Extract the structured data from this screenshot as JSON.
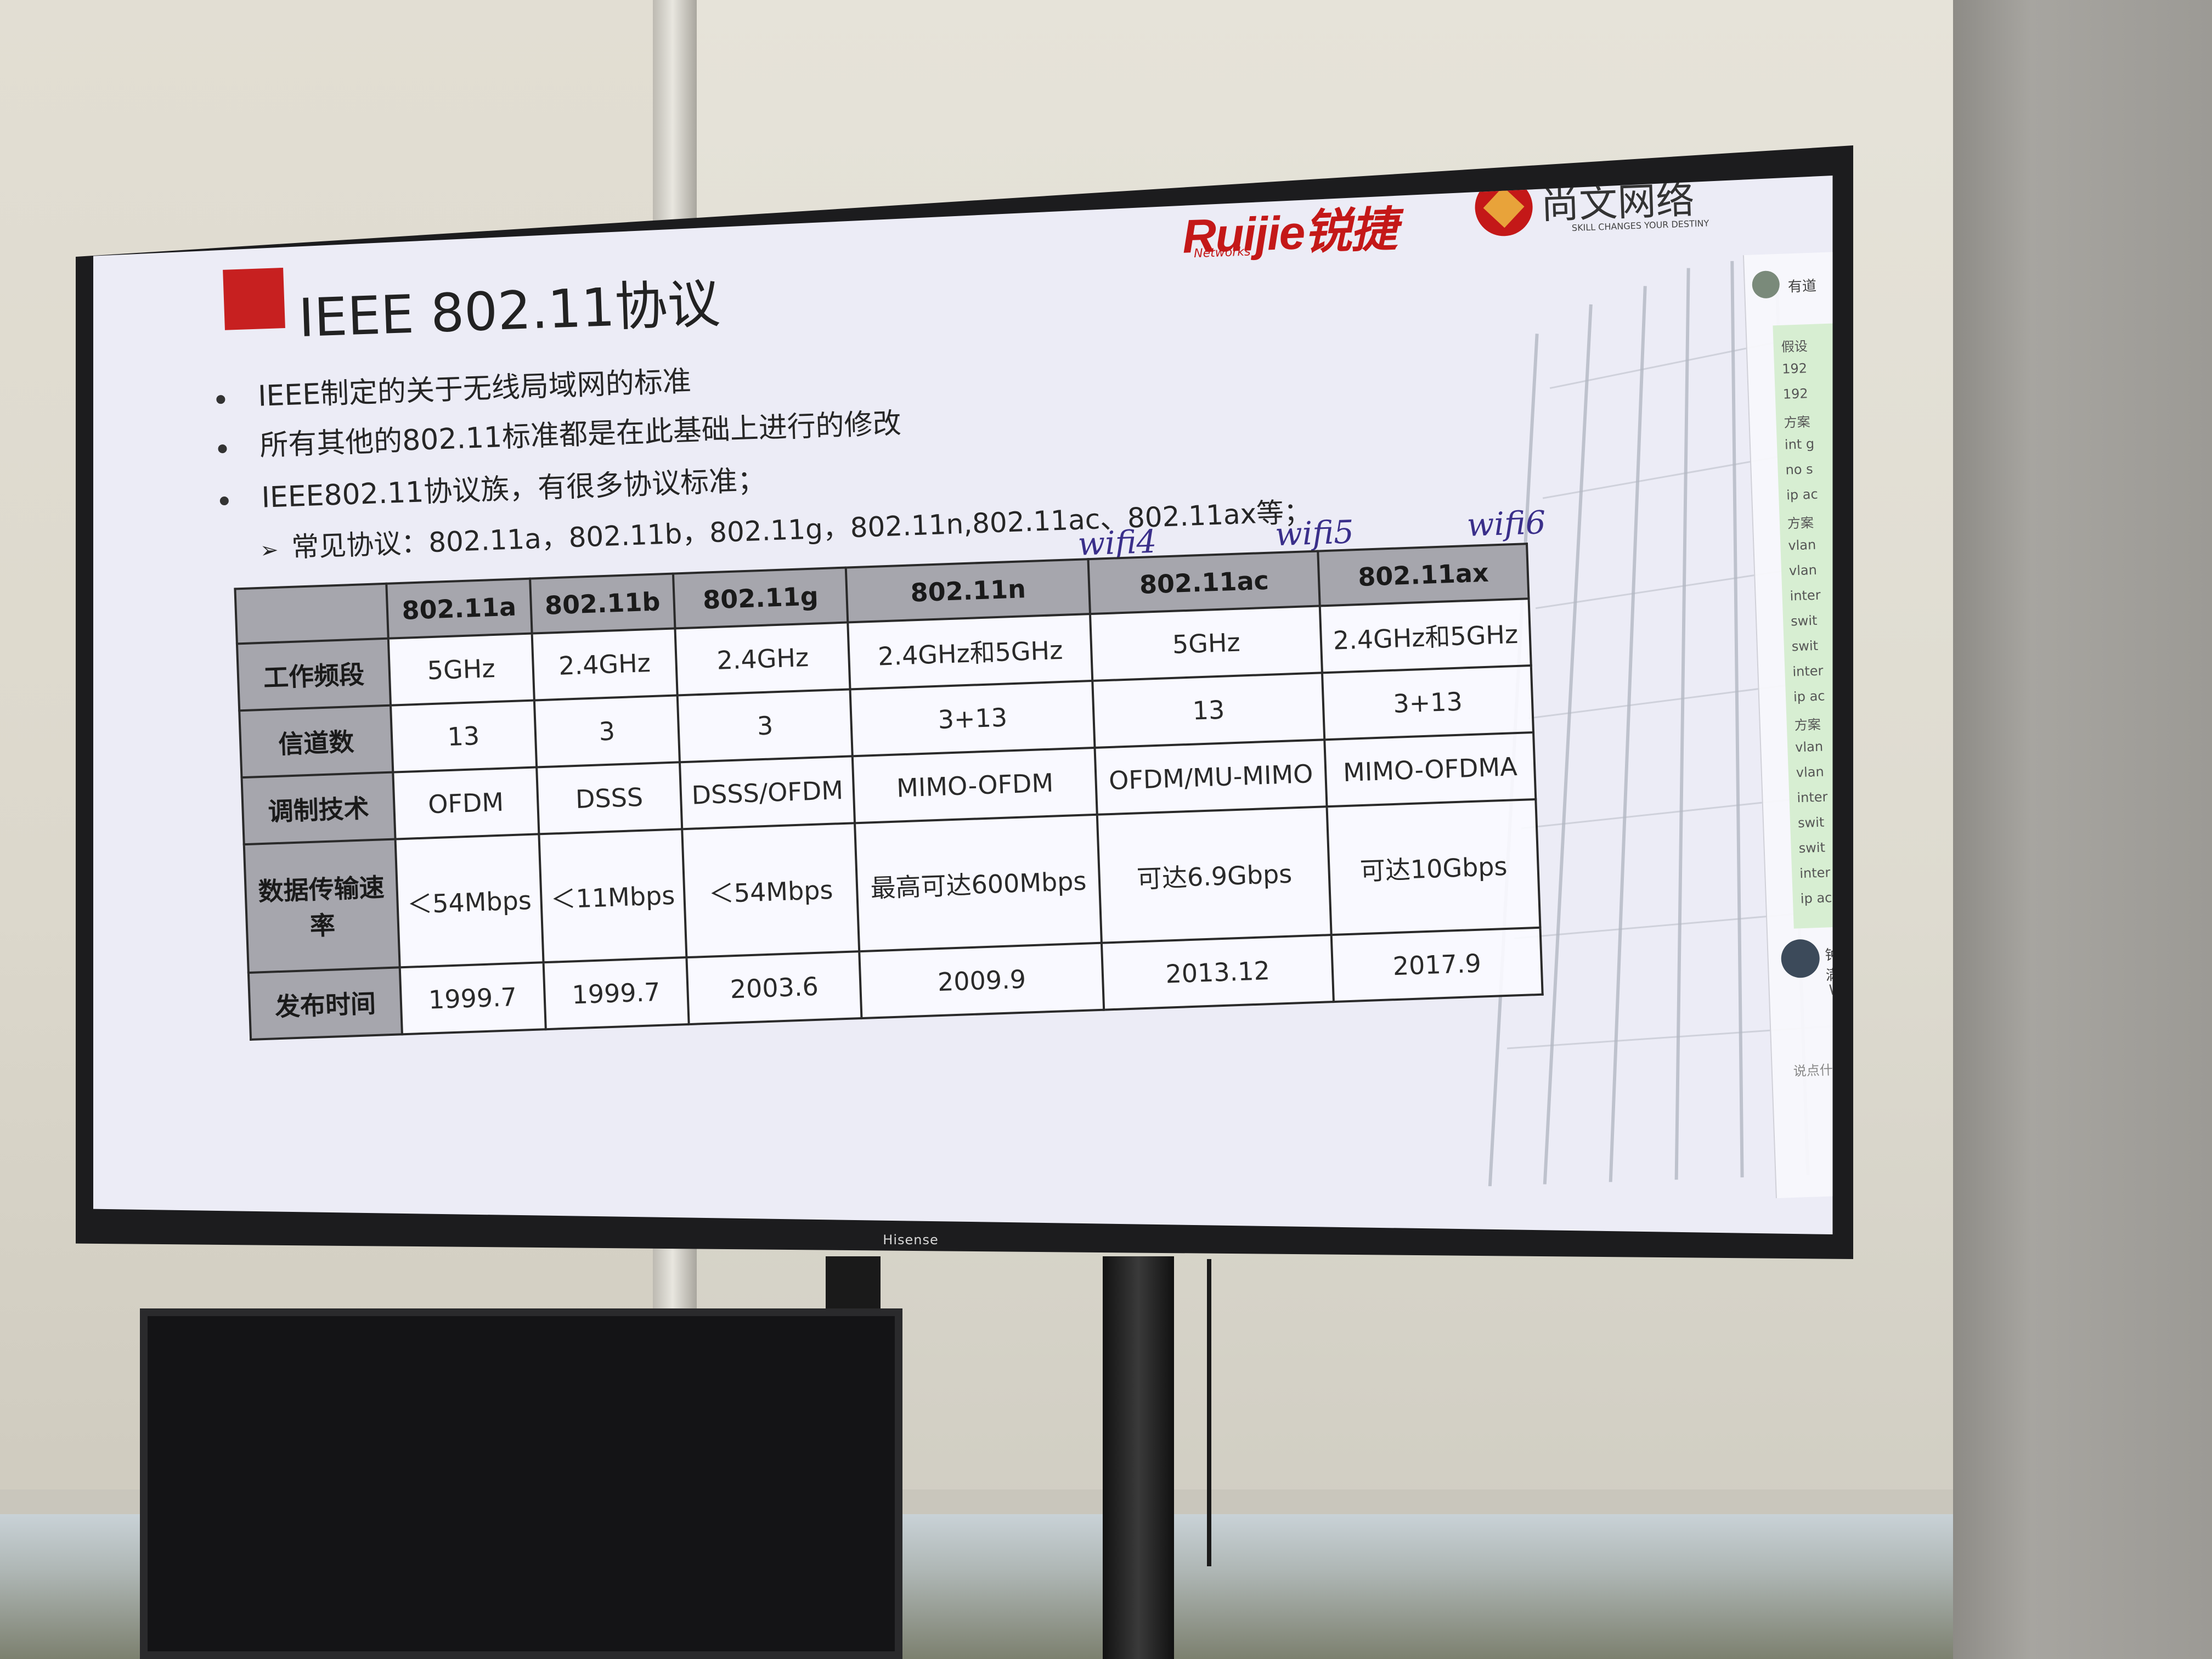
{
  "slide": {
    "title": "IEEE 802.11协议",
    "bullets": [
      "IEEE制定的关于无线局域网的标准",
      "所有其他的802.11标准都是在此基础上进行的修改",
      "IEEE802.11协议族，有很多协议标准；"
    ],
    "sub_bullet": "常见协议：802.11a，802.11b，802.11g，802.11n,802.11ac、802.11ax等；",
    "handwritten_notes": [
      "wifi4",
      "wifi5",
      "wifi6"
    ],
    "logos": {
      "ruijie": "Ruijie锐捷",
      "ruijie_sub": "Networks",
      "shangwen": "尚文网络",
      "shangwen_sub": "SKILL CHANGES YOUR DESTINY"
    },
    "table": {
      "headers": [
        "",
        "802.11a",
        "802.11b",
        "802.11g",
        "802.11n",
        "802.11ac",
        "802.11ax"
      ],
      "rows": [
        {
          "label": "工作频段",
          "cells": [
            "5GHz",
            "2.4GHz",
            "2.4GHz",
            "2.4GHz和5GHz",
            "5GHz",
            "2.4GHz和5GHz"
          ]
        },
        {
          "label": "信道数",
          "cells": [
            "13",
            "3",
            "3",
            "3+13",
            "13",
            "3+13"
          ]
        },
        {
          "label": "调制技术",
          "cells": [
            "OFDM",
            "DSSS",
            "DSSS/OFDM",
            "MIMO-OFDM",
            "OFDM/MU-MIMO",
            "MIMO-OFDMA"
          ]
        },
        {
          "label": "数据传输速率",
          "cells": [
            "＜54Mbps",
            "＜11Mbps",
            "＜54Mbps",
            "最高可达600Mbps",
            "可达6.9Gbps",
            "可达10Gbps"
          ]
        },
        {
          "label": "发布时间",
          "cells": [
            "1999.7",
            "1999.7",
            "2003.6",
            "2009.9",
            "2013.12",
            "2017.9"
          ]
        }
      ]
    },
    "side_panel": {
      "title": "有道",
      "chat_lines": [
        "假设",
        "192",
        "192",
        "方案",
        "int g",
        "no s",
        "ip ac",
        "方案",
        "vlan",
        "vlan",
        "inter",
        "swit",
        "swit",
        "inter",
        "ip ac",
        "方案",
        "vlan",
        "vlan",
        "inter",
        "swit",
        "swit",
        "inter",
        "ip ac"
      ],
      "user_name": "钟放满",
      "user_msg": "WIFI",
      "input_placeholder": "说点什么..."
    }
  },
  "tv": {
    "brand": "Hisense"
  }
}
